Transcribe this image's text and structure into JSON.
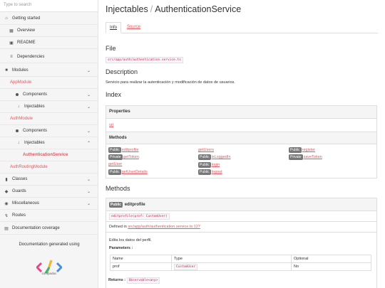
{
  "sidebar": {
    "search_placeholder": "Type to search",
    "items": [
      {
        "label": "Getting started",
        "icon": "home-icon"
      },
      {
        "label": "Overview",
        "icon": "grid-icon"
      },
      {
        "label": "README",
        "icon": "book-icon"
      },
      {
        "label": "Dependencies",
        "icon": "list-icon"
      },
      {
        "label": "Modules",
        "icon": "archive-icon"
      },
      {
        "label": "AppModule"
      },
      {
        "label": "Components"
      },
      {
        "label": "Injectables"
      },
      {
        "label": "AuthModule"
      },
      {
        "label": "Components"
      },
      {
        "label": "Injectables"
      },
      {
        "label": "AuthenticationService"
      },
      {
        "label": "AuthRoutingModule"
      },
      {
        "label": "Classes",
        "icon": "file-icon"
      },
      {
        "label": "Guards",
        "icon": "lock-icon"
      },
      {
        "label": "Miscellaneous",
        "icon": "cube-icon"
      },
      {
        "label": "Routes",
        "icon": "route-icon"
      },
      {
        "label": "Documentation coverage",
        "icon": "tasks-icon"
      }
    ],
    "generated_text": "Documentation generated using",
    "logo_text": "compodoc"
  },
  "main": {
    "breadcrumb_root": "Injectables",
    "breadcrumb_sep": "/",
    "breadcrumb_current": "AuthenticationService",
    "tabs": [
      {
        "label": "Info"
      },
      {
        "label": "Source"
      }
    ],
    "file_heading": "File",
    "file_path": "src/app/auth/authentication.service.ts",
    "description_heading": "Description",
    "description_text": "Servicio para realizar la autenticación y modificación de datos de usuarios.",
    "index_heading": "Index",
    "properties_heading": "Properties",
    "properties": [
      {
        "name": "url"
      }
    ],
    "methods_heading": "Methods",
    "methods": [
      {
        "badge": "Public",
        "name": "editprofile"
      },
      {
        "badge": "Private",
        "name": "getToken"
      },
      {
        "badge": "",
        "name": "getUser"
      },
      {
        "badge": "Public",
        "name": "getUserDetails"
      },
      {
        "badge": "",
        "name": "getUsers"
      },
      {
        "badge": "Public",
        "name": "isLoggedIn"
      },
      {
        "badge": "Public",
        "name": "login"
      },
      {
        "badge": "Public",
        "name": "logout"
      },
      {
        "badge": "Public",
        "name": "register"
      },
      {
        "badge": "Private",
        "name": "saveToken"
      }
    ],
    "methods_section_heading": "Methods",
    "method_detail": {
      "badge": "Public",
      "name": "editprofile",
      "signature": "editprofile(prof: CustomUser)",
      "defined_in_prefix": "Defined in",
      "defined_in_link": "src/app/auth/authentication.service.ts:127",
      "summary": "Edita los datos del perfil.",
      "parameters_label": "Parameters :",
      "param_headers": [
        "Name",
        "Type",
        "Optional"
      ],
      "params": [
        {
          "name": "prof",
          "type": "CustomUser",
          "optional": "No"
        }
      ],
      "returns_label": "Returns :",
      "returns_type": "Observable<any>"
    }
  },
  "colors": {
    "accent": "#e0585e",
    "badge": "#777777",
    "sidebar_bg": "#f5f5f5"
  }
}
